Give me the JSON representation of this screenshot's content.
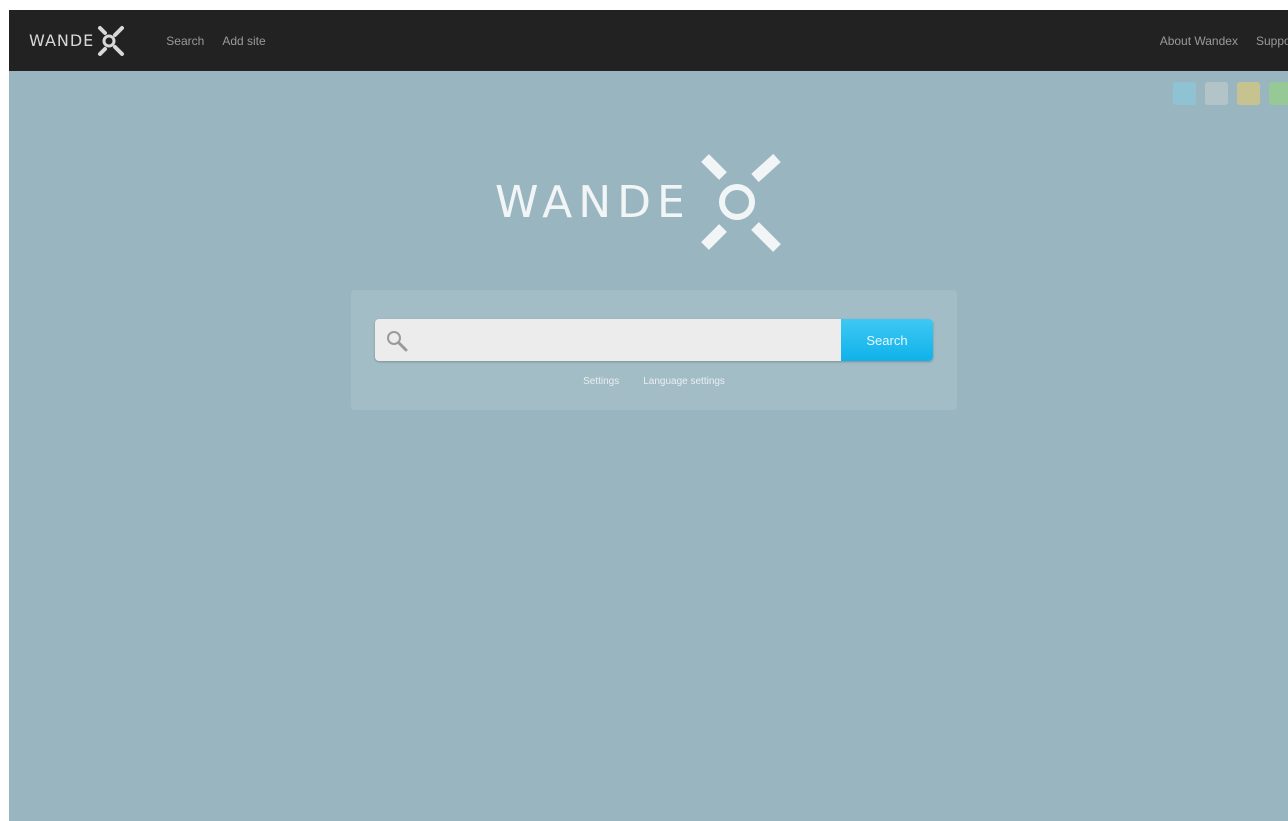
{
  "brand": {
    "name": "WANDEX"
  },
  "topbar": {
    "logo_text": "WANDE",
    "nav_left": [
      {
        "label": "Search"
      },
      {
        "label": "Add site"
      }
    ],
    "nav_right": [
      {
        "label": "About Wandex"
      },
      {
        "label": "Support"
      }
    ]
  },
  "theme_swatches": [
    {
      "name": "blue",
      "color": "#8fc3d4"
    },
    {
      "name": "grey",
      "color": "#b3c4c8"
    },
    {
      "name": "yellow",
      "color": "#c7c391"
    },
    {
      "name": "green",
      "color": "#96c996"
    }
  ],
  "hero": {
    "logo_text": "WANDE"
  },
  "search": {
    "placeholder": "",
    "value": "",
    "button_label": "Search",
    "links": [
      {
        "label": "Settings"
      },
      {
        "label": "Language settings"
      }
    ]
  },
  "colors": {
    "background": "#99b6c0",
    "topbar": "#222222",
    "accent": "#16b6ec"
  },
  "icons": {
    "search": "search-icon",
    "logo_mark": "magnifier-x-icon"
  }
}
